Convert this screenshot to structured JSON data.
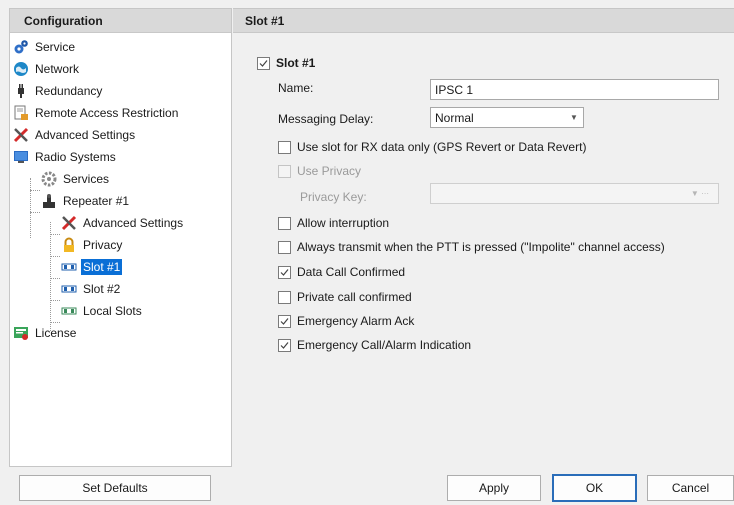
{
  "left_panel": {
    "header": "Configuration",
    "tree": [
      {
        "label": "Service",
        "icon": "gears-icon"
      },
      {
        "label": "Network",
        "icon": "globe-icon"
      },
      {
        "label": "Redundancy",
        "icon": "plug-icon"
      },
      {
        "label": "Remote Access Restriction",
        "icon": "document-lock-icon"
      },
      {
        "label": "Advanced Settings",
        "icon": "tools-icon"
      },
      {
        "label": "Radio Systems",
        "icon": "monitor-icon"
      },
      {
        "label": "Services",
        "icon": "gear-icon"
      },
      {
        "label": "Repeater #1",
        "icon": "repeater-icon"
      },
      {
        "label": "Advanced Settings",
        "icon": "tools-icon"
      },
      {
        "label": "Privacy",
        "icon": "padlock-icon"
      },
      {
        "label": "Slot #1",
        "icon": "slot-icon"
      },
      {
        "label": "Slot #2",
        "icon": "slot-icon"
      },
      {
        "label": "Local Slots",
        "icon": "local-slots-icon"
      },
      {
        "label": "License",
        "icon": "license-icon"
      }
    ],
    "selected_item": "Slot #1"
  },
  "right_panel": {
    "header": "Slot #1",
    "slot_checkbox_label": "Slot #1",
    "slot_enabled": true,
    "name_label": "Name:",
    "name_value": "IPSC 1",
    "messaging_delay_label": "Messaging Delay:",
    "messaging_delay_value": "Normal",
    "options": [
      {
        "label": "Use slot for RX data only (GPS Revert or Data Revert)",
        "checked": false,
        "enabled": true
      },
      {
        "label": "Use Privacy",
        "checked": false,
        "enabled": false
      }
    ],
    "privacy_key_label": "Privacy Key:",
    "privacy_key_value": "",
    "options2": [
      {
        "label": "Allow interruption",
        "checked": false
      },
      {
        "label": "Always transmit when the PTT is pressed (\"Impolite\" channel access)",
        "checked": false
      },
      {
        "label": "Data Call Confirmed",
        "checked": true
      },
      {
        "label": "Private call confirmed",
        "checked": false
      },
      {
        "label": "Emergency Alarm Ack",
        "checked": true
      },
      {
        "label": "Emergency Call/Alarm Indication",
        "checked": true
      }
    ]
  },
  "buttons": {
    "set_defaults": "Set Defaults",
    "apply": "Apply",
    "ok": "OK",
    "cancel": "Cancel"
  },
  "colors": {
    "selection": "#0a6fd6",
    "header_bg": "#d9d9d9",
    "default_button_border": "#2a6db9"
  }
}
